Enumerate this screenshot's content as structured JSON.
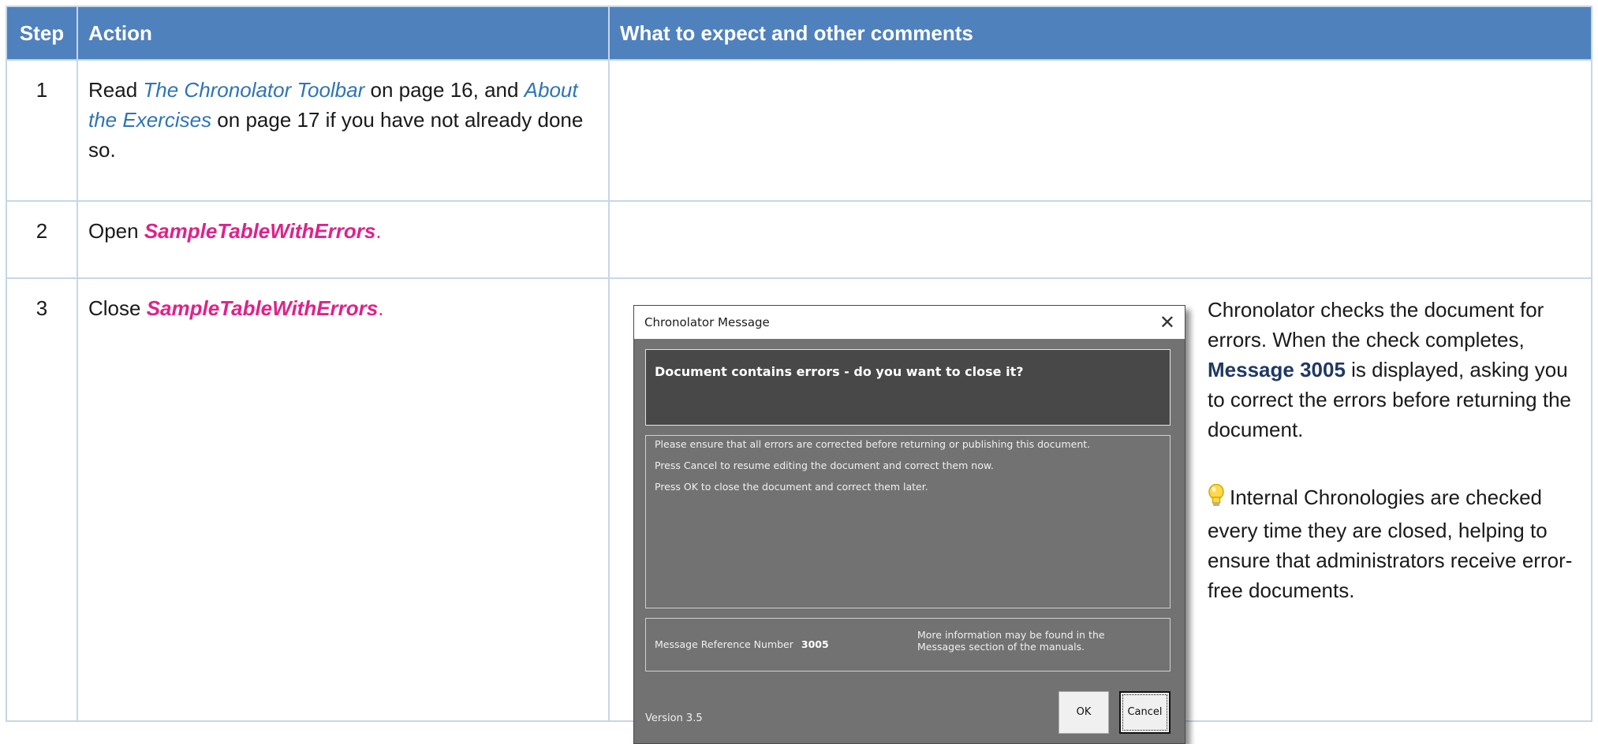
{
  "table": {
    "headers": [
      "Step",
      "Action",
      "What to expect and other comments"
    ],
    "rows": [
      {
        "step": "1",
        "action": {
          "pre": "Read ",
          "link1": "The Chronolator Toolbar",
          "mid1": " on page 16, and ",
          "link2": "About the Exercises",
          "mid2": " on page 17 if you have not already done so."
        }
      },
      {
        "step": "2",
        "action": {
          "pre": "Open ",
          "file": "SampleTableWithErrors",
          "post": "."
        }
      },
      {
        "step": "3",
        "action": {
          "pre": "Close ",
          "file": "SampleTableWithErrors",
          "post": "."
        },
        "comment": {
          "p1_pre": "Chronolator checks the document for errors. When the check completes, ",
          "p1_ref": "Message 3005",
          "p1_post": " is displayed, asking you to correct the errors before returning the document.",
          "tip_icon": "lightbulb-icon",
          "tip": "Internal Chronologies are checked every time they are closed, helping to ensure that administrators receive error-free documents."
        }
      }
    ]
  },
  "dialog": {
    "title": "Chronolator Message",
    "close_glyph": "✕",
    "heading": "Document contains errors - do you want to close it?",
    "body": [
      "Please ensure that all errors are corrected before returning or publishing this document.",
      "Press Cancel to resume editing the document and correct them now.",
      "Press OK to close the document and correct them later."
    ],
    "ref_label": "Message Reference Number",
    "ref_number": "3005",
    "more_info": "More information may be found in the Messages section of the manuals.",
    "version": "Version 3.5",
    "ok_label": "OK",
    "cancel_label": "Cancel"
  },
  "colors": {
    "header_bg": "#4f81bd",
    "link": "#2e74b5",
    "file": "#e0218a",
    "ref": "#1f3864"
  }
}
